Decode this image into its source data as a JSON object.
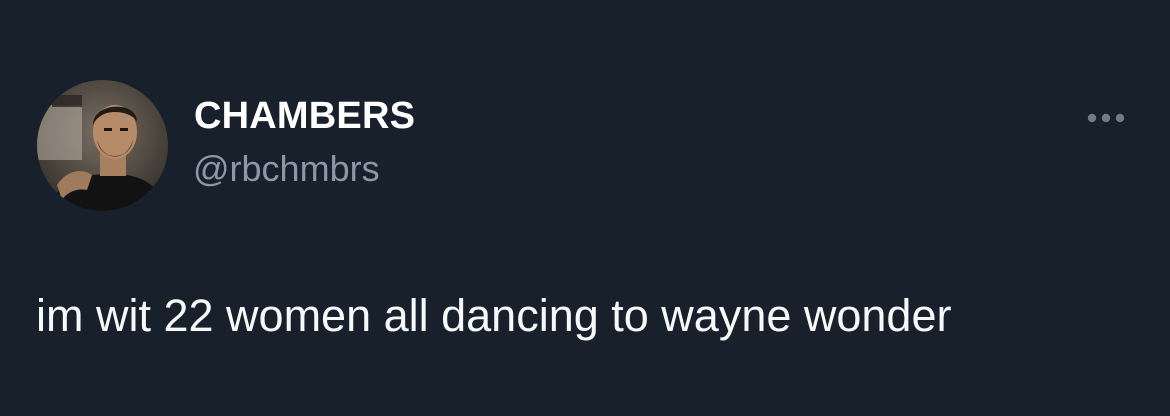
{
  "tweet": {
    "author": {
      "display_name": "CHAMBERS",
      "handle": "@rbchmbrs",
      "avatar_icon": "user-avatar-photo"
    },
    "more_icon": "more-options-icon",
    "text": "im wit 22 women all dancing to wayne wonder"
  },
  "colors": {
    "background": "#17202b",
    "name": "#ffffff",
    "handle": "#8b98a5",
    "body_text": "#f7f9f9"
  }
}
